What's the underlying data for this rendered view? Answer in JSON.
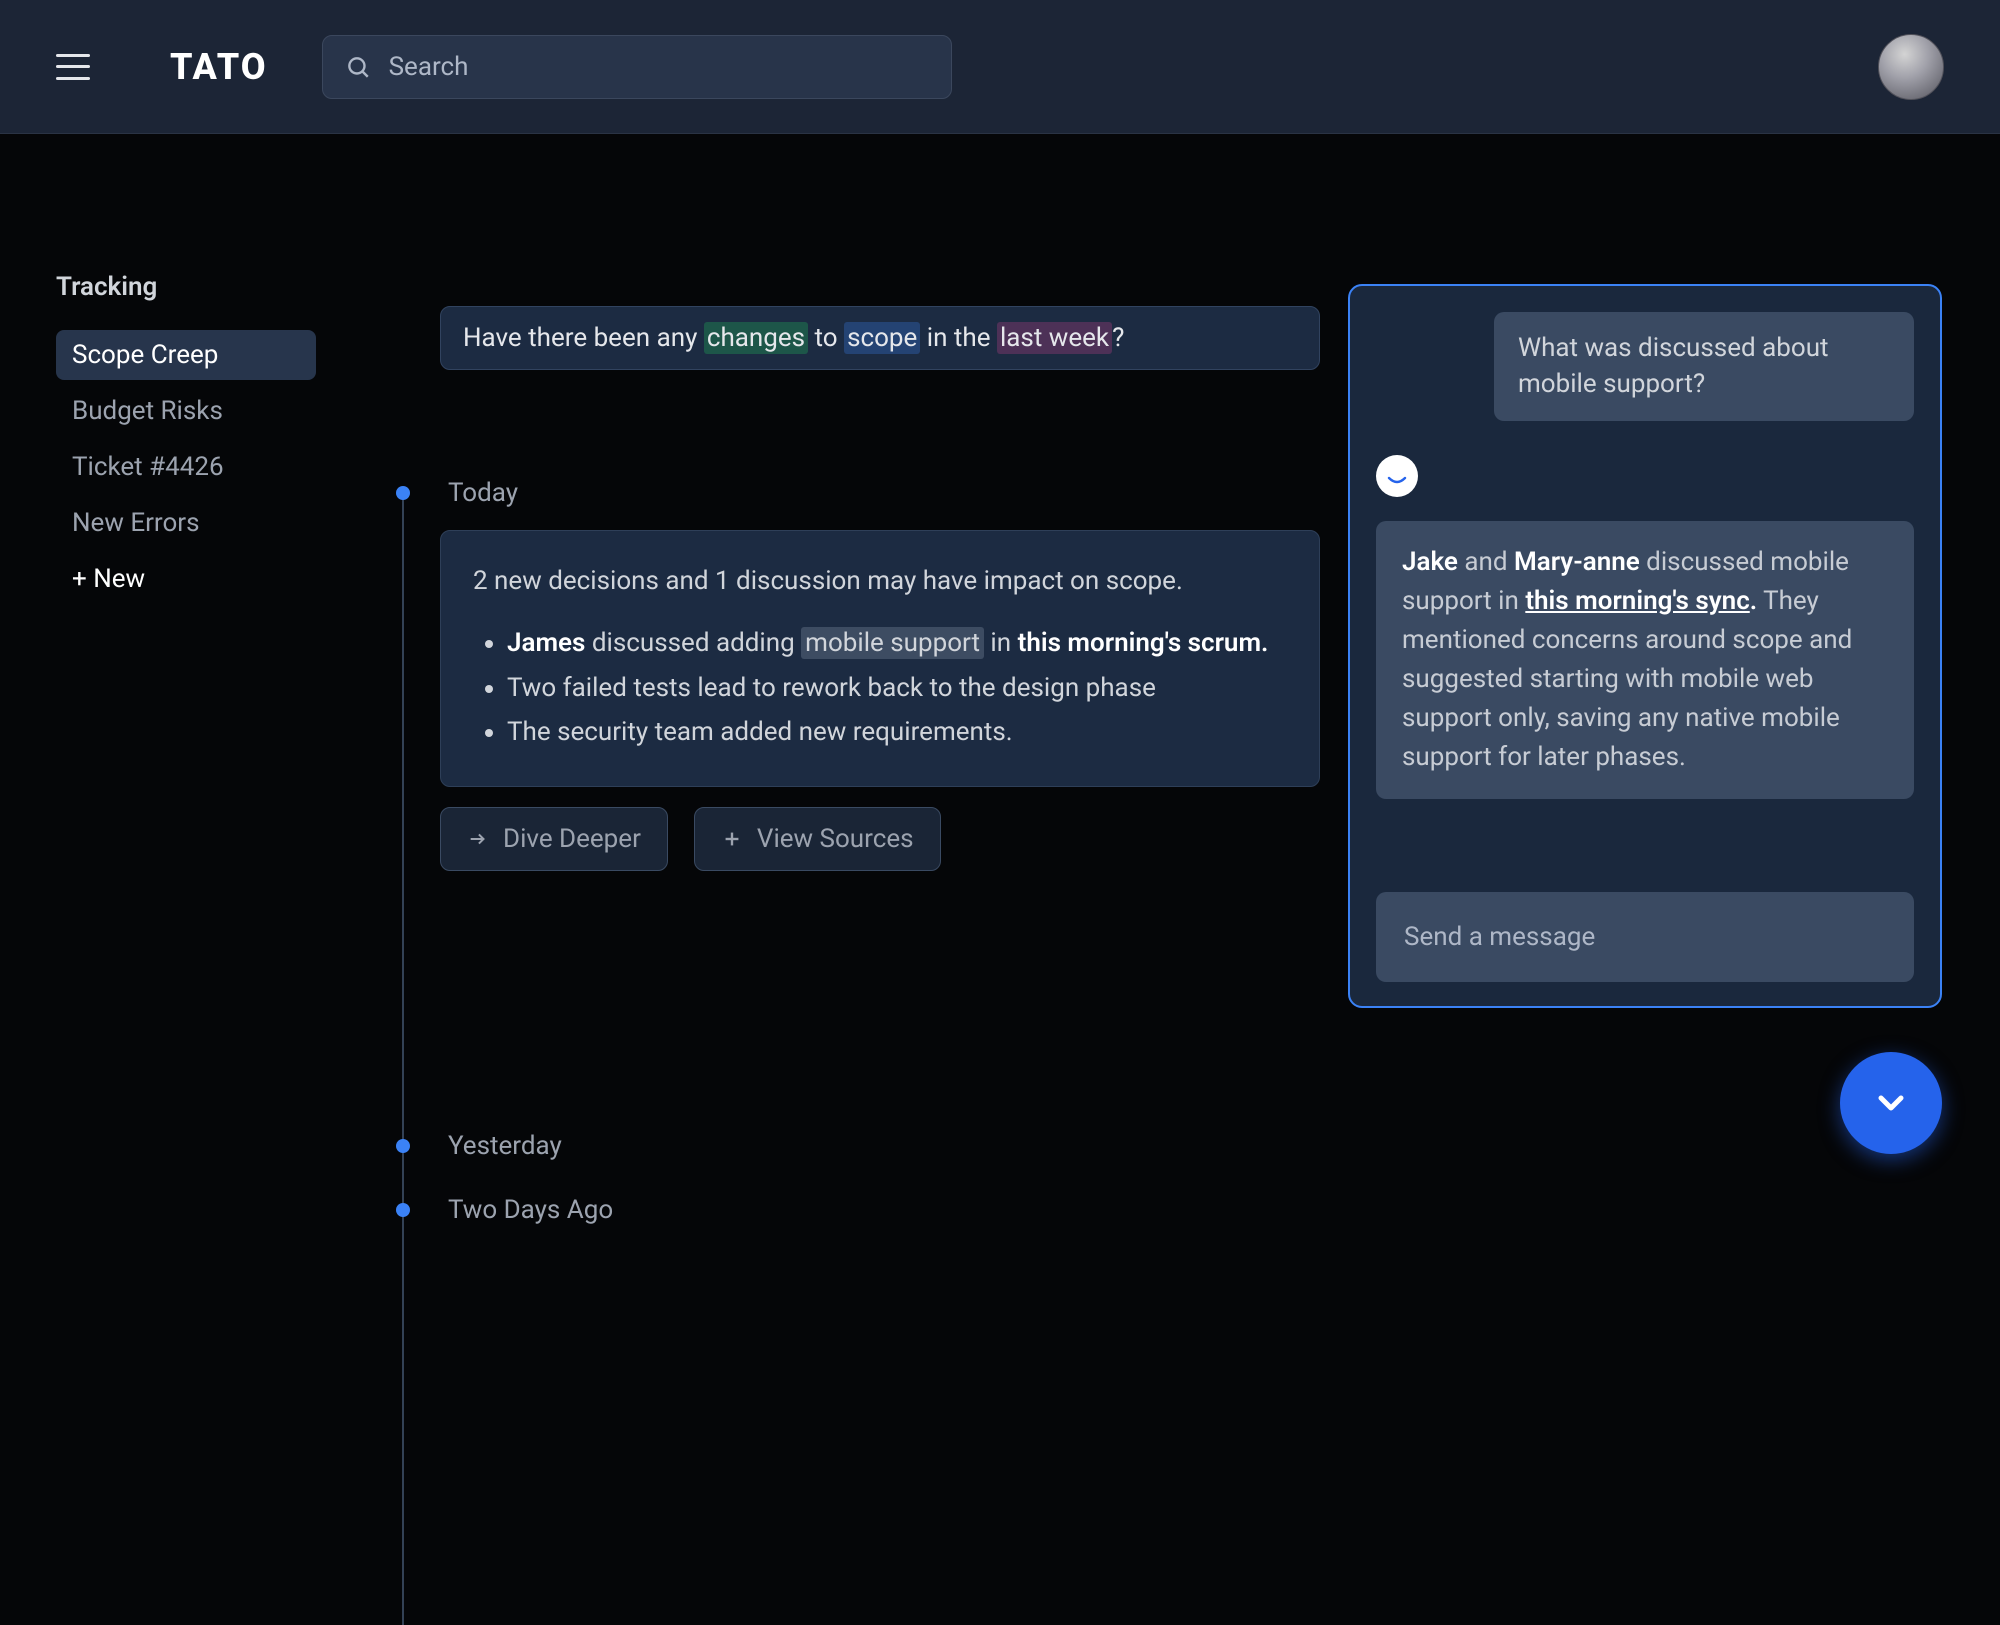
{
  "header": {
    "logo": "TATO",
    "search_placeholder": "Search"
  },
  "sidebar": {
    "title": "Tracking",
    "items": [
      {
        "label": "Scope Creep",
        "active": true
      },
      {
        "label": "Budget Risks",
        "active": false
      },
      {
        "label": "Ticket #4426",
        "active": false
      },
      {
        "label": "New Errors",
        "active": false
      }
    ],
    "new_label": "+ New"
  },
  "query": {
    "pre": "Have there been any ",
    "w1": "changes",
    "mid1": " to ",
    "w2": "scope",
    "mid2": " in the ",
    "w3": "last week",
    "post": "?"
  },
  "timeline": {
    "today": {
      "label": "Today",
      "summary": "2 new decisions and 1 discussion may have impact on scope.",
      "bullets": {
        "b1_name": "James",
        "b1_mid": " discussed adding ",
        "b1_hl": "mobile support",
        "b1_in": " in ",
        "b1_tail": "this morning's scrum.",
        "b2": "Two failed tests lead to rework back to the design phase",
        "b3": "The security team added new requirements."
      },
      "actions": {
        "dive": "Dive Deeper",
        "sources": "View Sources"
      }
    },
    "yesterday_label": "Yesterday",
    "twodays_label": "Two Days Ago"
  },
  "chat": {
    "user_msg": "What was discussed about mobile support?",
    "bot": {
      "n1": "Jake",
      "and": " and ",
      "n2": "Mary-anne",
      "p1": " discussed mobile support in ",
      "link": "this morning's sync",
      "dot": ".",
      "p2": " They mentioned concerns around scope and suggested starting with mobile web support only, saving any native mobile support for later phases."
    },
    "input_placeholder": "Send a message"
  }
}
